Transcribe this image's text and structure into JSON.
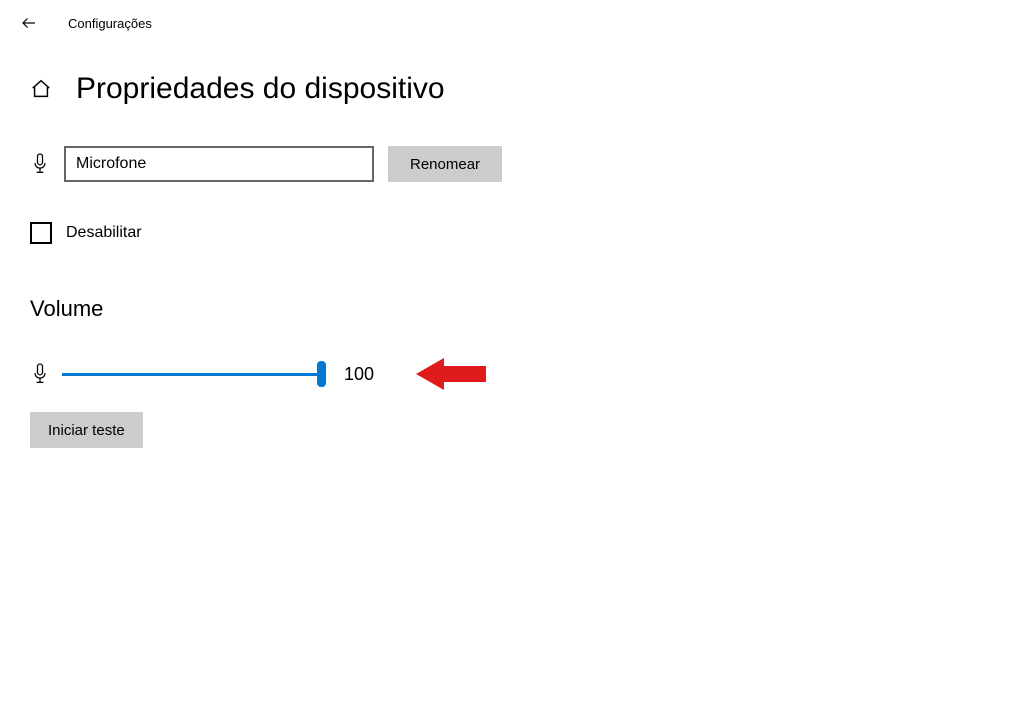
{
  "header": {
    "breadcrumb": "Configurações"
  },
  "page": {
    "title": "Propriedades do dispositivo"
  },
  "device": {
    "name_value": "Microfone",
    "rename_button": "Renomear"
  },
  "disable": {
    "label": "Desabilitar",
    "checked": false
  },
  "volume": {
    "section_label": "Volume",
    "value": "100",
    "percent": 100
  },
  "test": {
    "button_label": "Iniciar teste"
  },
  "colors": {
    "accent": "#0078d4",
    "button_bg": "#cccccc",
    "arrow_red": "#e01b1b"
  }
}
